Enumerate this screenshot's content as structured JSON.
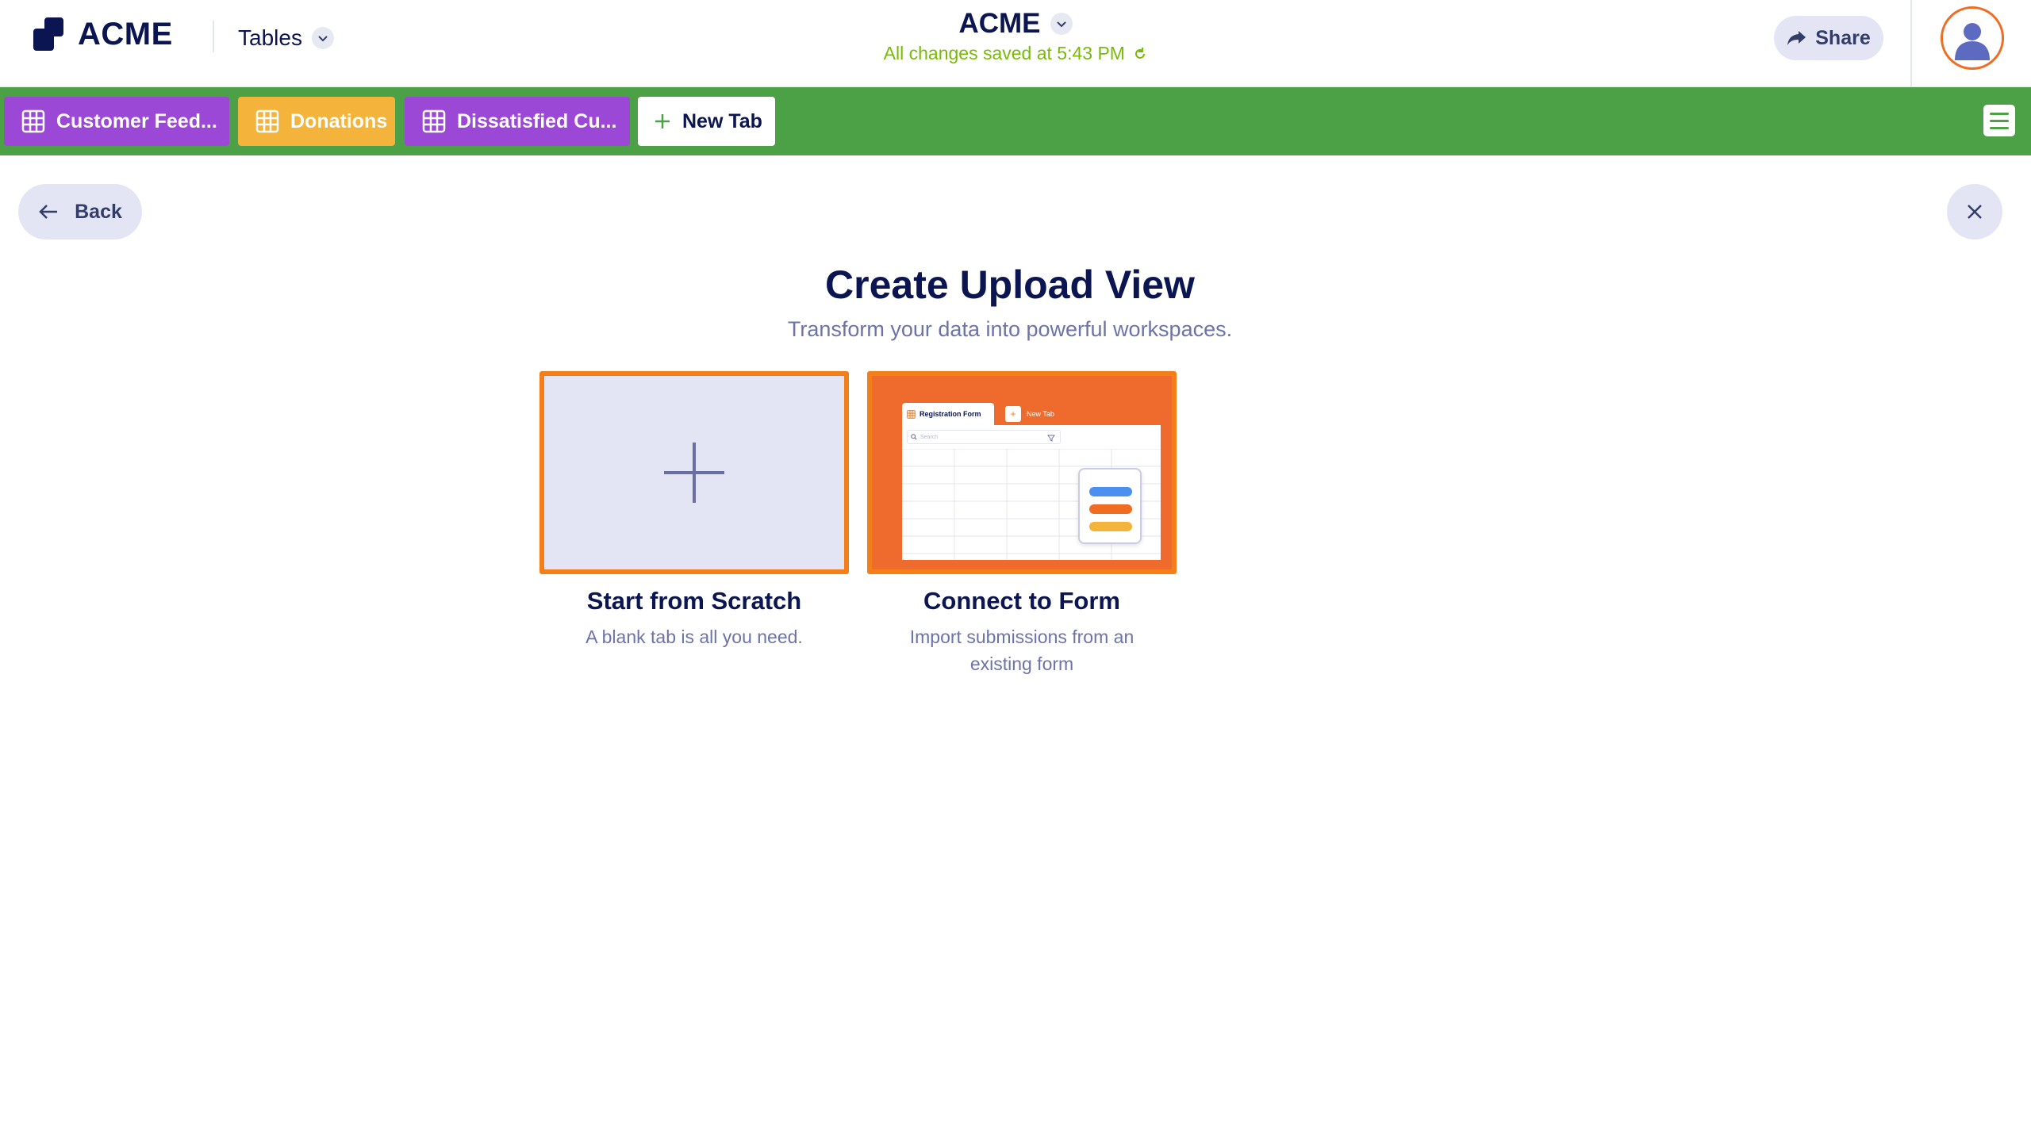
{
  "header": {
    "logo_text": "ACME",
    "product_selector": "Tables",
    "app_name": "ACME",
    "save_status": "All changes saved at 5:43 PM",
    "share_label": "Share"
  },
  "tabs": [
    {
      "label": "Customer Feed...",
      "color": "#9b48d6"
    },
    {
      "label": "Donations",
      "color": "#f4b33b"
    },
    {
      "label": "Dissatisfied Cu...",
      "color": "#9b48d6"
    }
  ],
  "new_tab_label": "New Tab",
  "colors": {
    "tabbar": "#4ca046",
    "accent": "#f47f18",
    "save_status": "#78bb07"
  },
  "nav": {
    "back_label": "Back"
  },
  "page": {
    "title": "Create Upload View",
    "subtitle": "Transform your data into powerful workspaces."
  },
  "options": [
    {
      "title": "Start from Scratch",
      "description": "A blank tab is all you need."
    },
    {
      "title": "Connect to Form",
      "description_line1": "Import submissions from an",
      "description_line2": "existing form",
      "preview": {
        "tab_label": "Registration Form",
        "new_tab_label": "New Tab",
        "search_placeholder": "Search"
      }
    }
  ]
}
